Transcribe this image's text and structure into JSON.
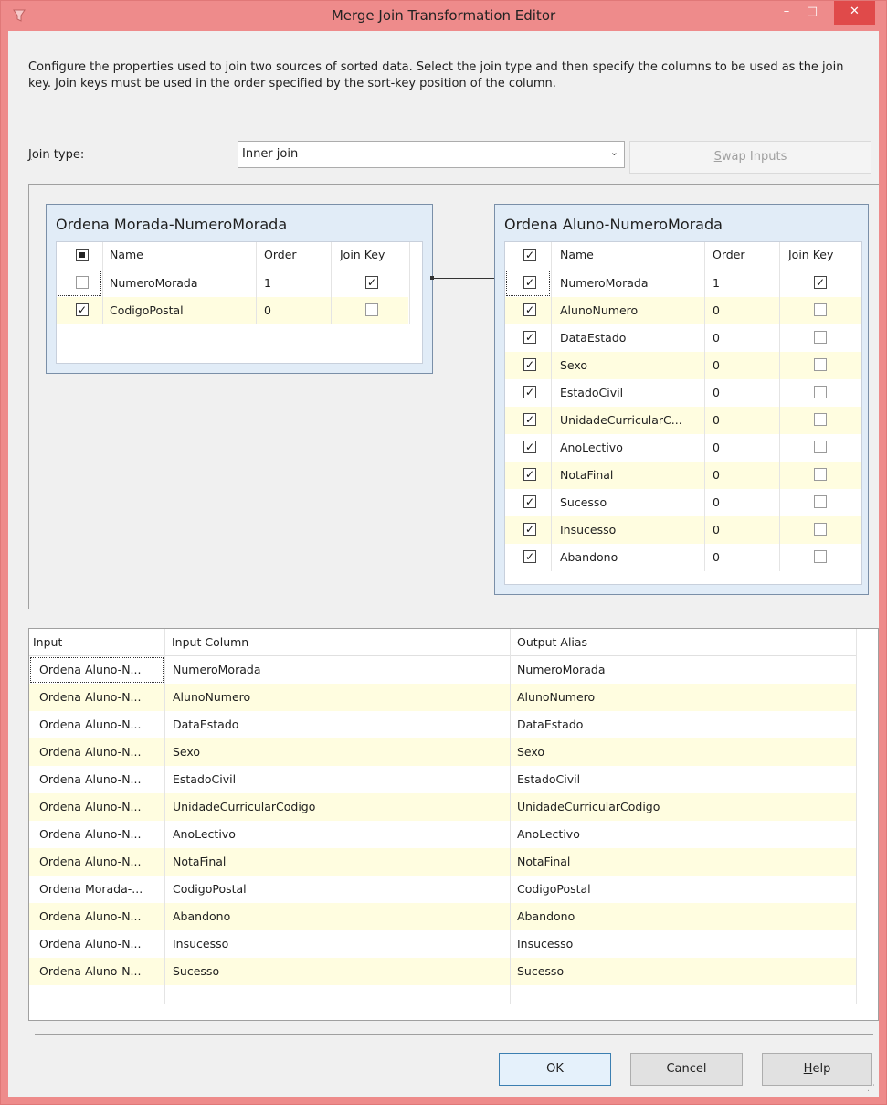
{
  "window": {
    "title": "Merge Join Transformation Editor",
    "minimize_glyph": "–",
    "maximize_glyph": "□",
    "close_glyph": "✕"
  },
  "description": "Configure the properties used to join two sources of sorted data. Select the join type and then specify the columns to be used as the join key. Join keys must be used in the order specified by the sort-key position of the column.",
  "join_type": {
    "label_accel": "J",
    "label_rest": "oin type:",
    "value": "Inner join",
    "arrow": "⌄",
    "swap_accel": "S",
    "swap_rest": "wap Inputs"
  },
  "left_input": {
    "title": "Ordena Morada-NumeroMorada",
    "headers": {
      "name": "Name",
      "order": "Order",
      "join_key": "Join Key"
    },
    "rows": [
      {
        "name": "NumeroMorada",
        "order": "1",
        "checked": false,
        "join_key": true
      },
      {
        "name": "CodigoPostal",
        "order": "0",
        "checked": true,
        "join_key": false
      }
    ]
  },
  "right_input": {
    "title": "Ordena Aluno-NumeroMorada",
    "headers": {
      "name": "Name",
      "order": "Order",
      "join_key": "Join Key"
    },
    "rows": [
      {
        "name": "NumeroMorada",
        "order": "1",
        "checked": true,
        "join_key": true
      },
      {
        "name": "AlunoNumero",
        "order": "0",
        "checked": true,
        "join_key": false
      },
      {
        "name": "DataEstado",
        "order": "0",
        "checked": true,
        "join_key": false
      },
      {
        "name": "Sexo",
        "order": "0",
        "checked": true,
        "join_key": false
      },
      {
        "name": "EstadoCivil",
        "order": "0",
        "checked": true,
        "join_key": false
      },
      {
        "name": "UnidadeCurricularC...",
        "order": "0",
        "checked": true,
        "join_key": false
      },
      {
        "name": "AnoLectivo",
        "order": "0",
        "checked": true,
        "join_key": false
      },
      {
        "name": "NotaFinal",
        "order": "0",
        "checked": true,
        "join_key": false
      },
      {
        "name": "Sucesso",
        "order": "0",
        "checked": true,
        "join_key": false
      },
      {
        "name": "Insucesso",
        "order": "0",
        "checked": true,
        "join_key": false
      },
      {
        "name": "Abandono",
        "order": "0",
        "checked": true,
        "join_key": false
      }
    ]
  },
  "mapping": {
    "headers": {
      "input": "Input",
      "input_column": "Input Column",
      "output_alias": "Output Alias"
    },
    "rows": [
      {
        "input": "Ordena Aluno-N...",
        "input_column": "NumeroMorada",
        "output_alias": "NumeroMorada"
      },
      {
        "input": "Ordena Aluno-N...",
        "input_column": "AlunoNumero",
        "output_alias": "AlunoNumero"
      },
      {
        "input": "Ordena Aluno-N...",
        "input_column": "DataEstado",
        "output_alias": "DataEstado"
      },
      {
        "input": "Ordena Aluno-N...",
        "input_column": "Sexo",
        "output_alias": "Sexo"
      },
      {
        "input": "Ordena Aluno-N...",
        "input_column": "EstadoCivil",
        "output_alias": "EstadoCivil"
      },
      {
        "input": "Ordena Aluno-N...",
        "input_column": "UnidadeCurricularCodigo",
        "output_alias": "UnidadeCurricularCodigo"
      },
      {
        "input": "Ordena Aluno-N...",
        "input_column": "AnoLectivo",
        "output_alias": "AnoLectivo"
      },
      {
        "input": "Ordena Aluno-N...",
        "input_column": "NotaFinal",
        "output_alias": "NotaFinal"
      },
      {
        "input": "Ordena Morada-...",
        "input_column": "CodigoPostal",
        "output_alias": "CodigoPostal"
      },
      {
        "input": "Ordena Aluno-N...",
        "input_column": "Abandono",
        "output_alias": "Abandono"
      },
      {
        "input": "Ordena Aluno-N...",
        "input_column": "Insucesso",
        "output_alias": "Insucesso"
      },
      {
        "input": "Ordena Aluno-N...",
        "input_column": "Sucesso",
        "output_alias": "Sucesso"
      }
    ]
  },
  "buttons": {
    "ok": "OK",
    "cancel": "Cancel",
    "help_accel": "H",
    "help_rest": "elp"
  },
  "colors": {
    "titlebar": "#ee8b8b",
    "alt_row": "#fffde0",
    "box_bg": "#e1ecf7"
  },
  "icons": {
    "check": "✓"
  }
}
